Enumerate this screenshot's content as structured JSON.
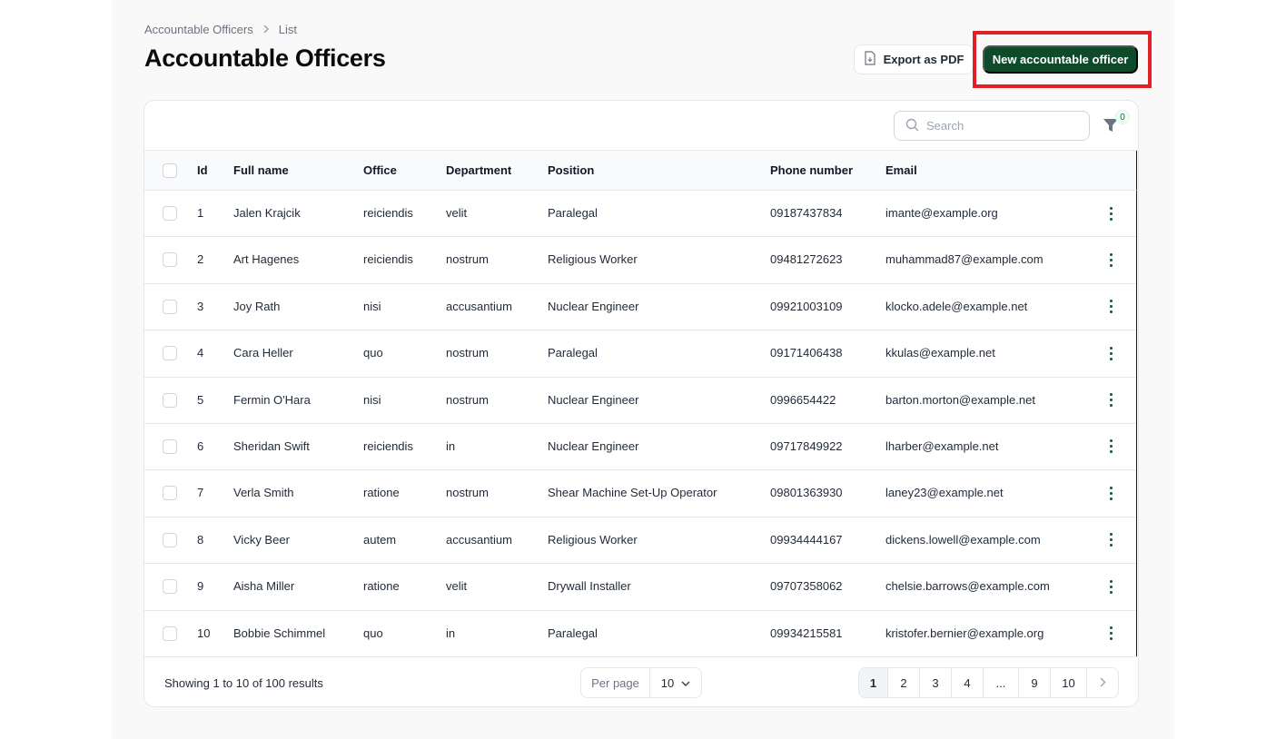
{
  "breadcrumb": {
    "items": [
      "Accountable Officers",
      "List"
    ],
    "separator": ">"
  },
  "page_title": "Accountable Officers",
  "actions": {
    "export_label": "Export as PDF",
    "new_label": "New accountable officer"
  },
  "toolbar": {
    "search_placeholder": "Search",
    "filter_count": "0"
  },
  "table": {
    "columns": [
      "Id",
      "Full name",
      "Office",
      "Department",
      "Position",
      "Phone number",
      "Email"
    ],
    "rows": [
      {
        "id": "1",
        "full_name": "Jalen Krajcik",
        "office": "reiciendis",
        "department": "velit",
        "position": "Paralegal",
        "phone": "09187437834",
        "email": "imante@example.org"
      },
      {
        "id": "2",
        "full_name": "Art Hagenes",
        "office": "reiciendis",
        "department": "nostrum",
        "position": "Religious Worker",
        "phone": "09481272623",
        "email": "muhammad87@example.com"
      },
      {
        "id": "3",
        "full_name": "Joy Rath",
        "office": "nisi",
        "department": "accusantium",
        "position": "Nuclear Engineer",
        "phone": "09921003109",
        "email": "klocko.adele@example.net"
      },
      {
        "id": "4",
        "full_name": "Cara Heller",
        "office": "quo",
        "department": "nostrum",
        "position": "Paralegal",
        "phone": "09171406438",
        "email": "kkulas@example.net"
      },
      {
        "id": "5",
        "full_name": "Fermin O'Hara",
        "office": "nisi",
        "department": "nostrum",
        "position": "Nuclear Engineer",
        "phone": "0996654422",
        "email": "barton.morton@example.net"
      },
      {
        "id": "6",
        "full_name": "Sheridan Swift",
        "office": "reiciendis",
        "department": "in",
        "position": "Nuclear Engineer",
        "phone": "09717849922",
        "email": "lharber@example.net"
      },
      {
        "id": "7",
        "full_name": "Verla Smith",
        "office": "ratione",
        "department": "nostrum",
        "position": "Shear Machine Set-Up Operator",
        "phone": "09801363930",
        "email": "laney23@example.net"
      },
      {
        "id": "8",
        "full_name": "Vicky Beer",
        "office": "autem",
        "department": "accusantium",
        "position": "Religious Worker",
        "phone": "09934444167",
        "email": "dickens.lowell@example.com"
      },
      {
        "id": "9",
        "full_name": "Aisha Miller",
        "office": "ratione",
        "department": "velit",
        "position": "Drywall Installer",
        "phone": "09707358062",
        "email": "chelsie.barrows@example.com"
      },
      {
        "id": "10",
        "full_name": "Bobbie Schimmel",
        "office": "quo",
        "department": "in",
        "position": "Paralegal",
        "phone": "09934215581",
        "email": "kristofer.bernier@example.org"
      }
    ]
  },
  "footer": {
    "showing": "Showing 1 to 10 of 100 results",
    "per_page_label": "Per page",
    "per_page_value": "10",
    "pages": [
      "1",
      "2",
      "3",
      "4",
      "...",
      "9",
      "10"
    ],
    "current_page": "1",
    "next_icon": "chevron-right-icon"
  },
  "colors": {
    "primary": "#0f4a2b",
    "highlight": "#e0212a",
    "action_dots": "#14532d"
  }
}
